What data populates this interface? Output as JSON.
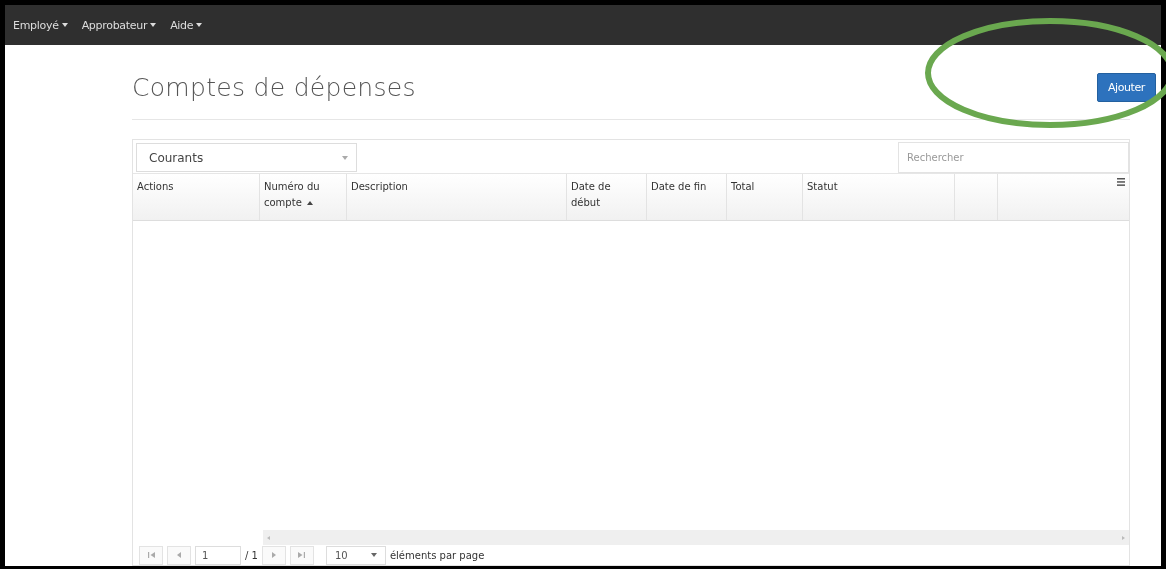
{
  "nav": {
    "items": [
      {
        "label": "Employé"
      },
      {
        "label": "Approbateur"
      },
      {
        "label": "Aide"
      }
    ]
  },
  "page": {
    "title": "Comptes de dépenses",
    "add_button": "Ajouter"
  },
  "filter": {
    "value": "Courants"
  },
  "search": {
    "placeholder": "Rechercher"
  },
  "table": {
    "columns": [
      {
        "label": "Actions",
        "sorted": false
      },
      {
        "label": "Numéro du compte",
        "sorted": true
      },
      {
        "label": "Description",
        "sorted": false
      },
      {
        "label": "Date de début",
        "sorted": false
      },
      {
        "label": "Date de fin",
        "sorted": false
      },
      {
        "label": "Total",
        "sorted": false
      },
      {
        "label": "Statut",
        "sorted": false
      }
    ]
  },
  "pager": {
    "page": "1",
    "of": "/ 1",
    "page_size": "10",
    "per_page_label": "éléments par page"
  }
}
